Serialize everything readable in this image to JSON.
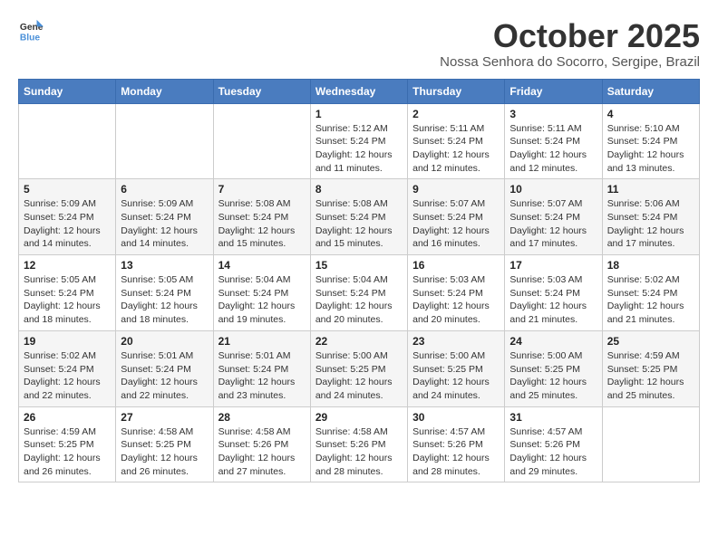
{
  "header": {
    "logo_line1": "General",
    "logo_line2": "Blue",
    "month": "October 2025",
    "location": "Nossa Senhora do Socorro, Sergipe, Brazil"
  },
  "weekdays": [
    "Sunday",
    "Monday",
    "Tuesday",
    "Wednesday",
    "Thursday",
    "Friday",
    "Saturday"
  ],
  "weeks": [
    [
      {
        "day": "",
        "info": ""
      },
      {
        "day": "",
        "info": ""
      },
      {
        "day": "",
        "info": ""
      },
      {
        "day": "1",
        "info": "Sunrise: 5:12 AM\nSunset: 5:24 PM\nDaylight: 12 hours\nand 11 minutes."
      },
      {
        "day": "2",
        "info": "Sunrise: 5:11 AM\nSunset: 5:24 PM\nDaylight: 12 hours\nand 12 minutes."
      },
      {
        "day": "3",
        "info": "Sunrise: 5:11 AM\nSunset: 5:24 PM\nDaylight: 12 hours\nand 12 minutes."
      },
      {
        "day": "4",
        "info": "Sunrise: 5:10 AM\nSunset: 5:24 PM\nDaylight: 12 hours\nand 13 minutes."
      }
    ],
    [
      {
        "day": "5",
        "info": "Sunrise: 5:09 AM\nSunset: 5:24 PM\nDaylight: 12 hours\nand 14 minutes."
      },
      {
        "day": "6",
        "info": "Sunrise: 5:09 AM\nSunset: 5:24 PM\nDaylight: 12 hours\nand 14 minutes."
      },
      {
        "day": "7",
        "info": "Sunrise: 5:08 AM\nSunset: 5:24 PM\nDaylight: 12 hours\nand 15 minutes."
      },
      {
        "day": "8",
        "info": "Sunrise: 5:08 AM\nSunset: 5:24 PM\nDaylight: 12 hours\nand 15 minutes."
      },
      {
        "day": "9",
        "info": "Sunrise: 5:07 AM\nSunset: 5:24 PM\nDaylight: 12 hours\nand 16 minutes."
      },
      {
        "day": "10",
        "info": "Sunrise: 5:07 AM\nSunset: 5:24 PM\nDaylight: 12 hours\nand 17 minutes."
      },
      {
        "day": "11",
        "info": "Sunrise: 5:06 AM\nSunset: 5:24 PM\nDaylight: 12 hours\nand 17 minutes."
      }
    ],
    [
      {
        "day": "12",
        "info": "Sunrise: 5:05 AM\nSunset: 5:24 PM\nDaylight: 12 hours\nand 18 minutes."
      },
      {
        "day": "13",
        "info": "Sunrise: 5:05 AM\nSunset: 5:24 PM\nDaylight: 12 hours\nand 18 minutes."
      },
      {
        "day": "14",
        "info": "Sunrise: 5:04 AM\nSunset: 5:24 PM\nDaylight: 12 hours\nand 19 minutes."
      },
      {
        "day": "15",
        "info": "Sunrise: 5:04 AM\nSunset: 5:24 PM\nDaylight: 12 hours\nand 20 minutes."
      },
      {
        "day": "16",
        "info": "Sunrise: 5:03 AM\nSunset: 5:24 PM\nDaylight: 12 hours\nand 20 minutes."
      },
      {
        "day": "17",
        "info": "Sunrise: 5:03 AM\nSunset: 5:24 PM\nDaylight: 12 hours\nand 21 minutes."
      },
      {
        "day": "18",
        "info": "Sunrise: 5:02 AM\nSunset: 5:24 PM\nDaylight: 12 hours\nand 21 minutes."
      }
    ],
    [
      {
        "day": "19",
        "info": "Sunrise: 5:02 AM\nSunset: 5:24 PM\nDaylight: 12 hours\nand 22 minutes."
      },
      {
        "day": "20",
        "info": "Sunrise: 5:01 AM\nSunset: 5:24 PM\nDaylight: 12 hours\nand 22 minutes."
      },
      {
        "day": "21",
        "info": "Sunrise: 5:01 AM\nSunset: 5:24 PM\nDaylight: 12 hours\nand 23 minutes."
      },
      {
        "day": "22",
        "info": "Sunrise: 5:00 AM\nSunset: 5:25 PM\nDaylight: 12 hours\nand 24 minutes."
      },
      {
        "day": "23",
        "info": "Sunrise: 5:00 AM\nSunset: 5:25 PM\nDaylight: 12 hours\nand 24 minutes."
      },
      {
        "day": "24",
        "info": "Sunrise: 5:00 AM\nSunset: 5:25 PM\nDaylight: 12 hours\nand 25 minutes."
      },
      {
        "day": "25",
        "info": "Sunrise: 4:59 AM\nSunset: 5:25 PM\nDaylight: 12 hours\nand 25 minutes."
      }
    ],
    [
      {
        "day": "26",
        "info": "Sunrise: 4:59 AM\nSunset: 5:25 PM\nDaylight: 12 hours\nand 26 minutes."
      },
      {
        "day": "27",
        "info": "Sunrise: 4:58 AM\nSunset: 5:25 PM\nDaylight: 12 hours\nand 26 minutes."
      },
      {
        "day": "28",
        "info": "Sunrise: 4:58 AM\nSunset: 5:26 PM\nDaylight: 12 hours\nand 27 minutes."
      },
      {
        "day": "29",
        "info": "Sunrise: 4:58 AM\nSunset: 5:26 PM\nDaylight: 12 hours\nand 28 minutes."
      },
      {
        "day": "30",
        "info": "Sunrise: 4:57 AM\nSunset: 5:26 PM\nDaylight: 12 hours\nand 28 minutes."
      },
      {
        "day": "31",
        "info": "Sunrise: 4:57 AM\nSunset: 5:26 PM\nDaylight: 12 hours\nand 29 minutes."
      },
      {
        "day": "",
        "info": ""
      }
    ]
  ]
}
